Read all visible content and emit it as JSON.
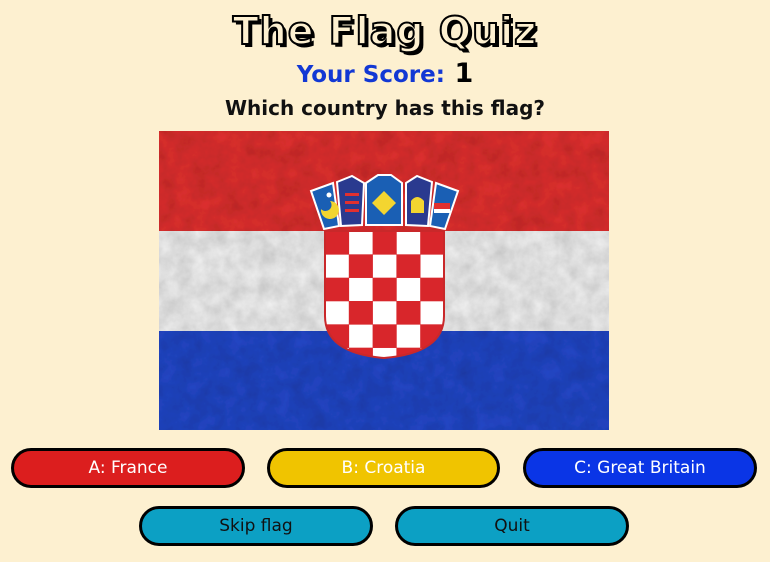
{
  "app": {
    "title": "The Flag Quiz"
  },
  "score": {
    "label": "Your Score:",
    "value": "1"
  },
  "question": "Which country has this flag?",
  "flag": {
    "country_depicted": "Croatia",
    "colors": {
      "red": "#e1302f",
      "white": "#f2f2f2",
      "blue": "#2247c8"
    }
  },
  "answers": [
    {
      "label": "A: France",
      "color": "#dc1e1e"
    },
    {
      "label": "B: Croatia",
      "color": "#f0c400"
    },
    {
      "label": "C: Great Britain",
      "color": "#0a35e6"
    }
  ],
  "actions": {
    "skip_label": "Skip flag",
    "quit_label": "Quit",
    "color": "#0ca0c4"
  },
  "colors": {
    "background": "#fdf0d0",
    "score_label": "#1238d4"
  }
}
